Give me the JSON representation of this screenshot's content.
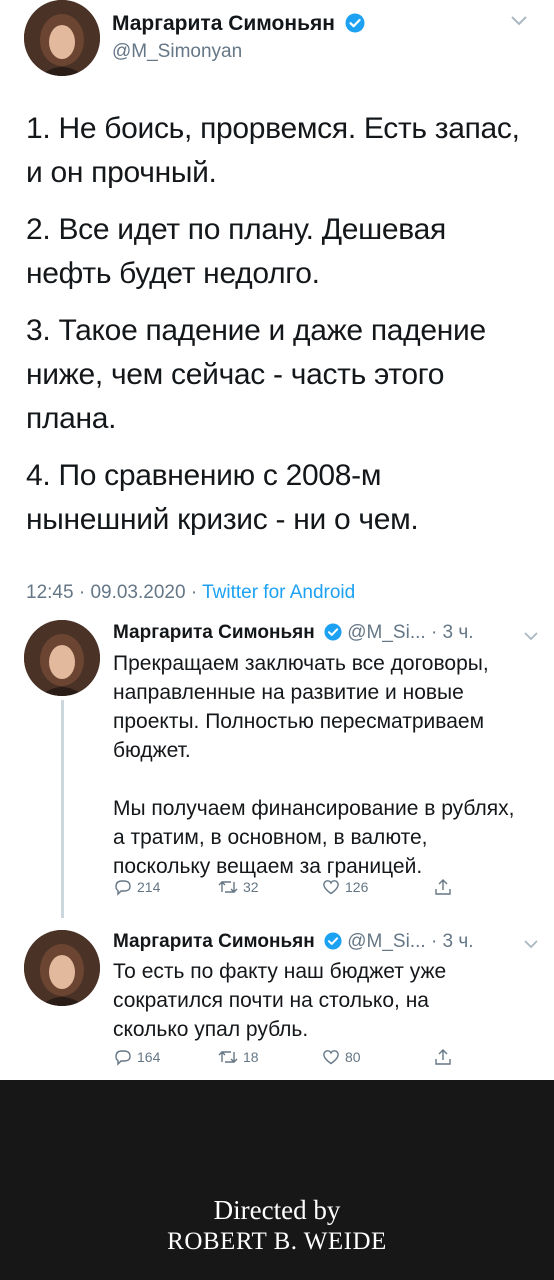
{
  "main_tweet": {
    "author_name": "Маргарита Симоньян",
    "handle": "@M_Simonyan",
    "lines": [
      "1. Не боись, прорвемся. Есть запас,",
      "и он прочный.",
      "2. Все идет по плану. Дешевая",
      "нефть будет недолго.",
      "3. Такое падение и даже падение",
      "ниже, чем сейчас - часть этого",
      "плана.",
      "4. По сравнению с 2008-м",
      "нынешний кризис - ни о чем."
    ],
    "time": "12:45",
    "date": "09.03.2020",
    "source": "Twitter for Android",
    "sep": "·"
  },
  "replies": [
    {
      "author_name": "Маргарита Симоньян",
      "handle_time": "@M_Si... · 3 ч.",
      "lines": [
        "Прекращаем заключать все договоры,",
        "направленные на развитие и новые",
        "проекты. Полностью пересматриваем",
        "бюджет.",
        "",
        "Мы получаем финансирование в рублях,",
        "а тратим, в основном, в валюте,",
        "поскольку вещаем за границей."
      ],
      "replies": "214",
      "retweets": "32",
      "likes": "126"
    },
    {
      "author_name": "Маргарита Симоньян",
      "handle_time": "@M_Si... · 3 ч.",
      "lines": [
        "То есть по факту наш бюджет уже",
        "сократился почти на столько, на",
        "сколько упал рубль."
      ],
      "replies": "164",
      "retweets": "18",
      "likes": "80"
    }
  ],
  "footer": {
    "line1": "Directed by",
    "line2": "ROBERT B. WEIDE"
  },
  "colors": {
    "verified": "#1da1f2",
    "link": "#1da1f2",
    "footer_bg": "#171717"
  }
}
